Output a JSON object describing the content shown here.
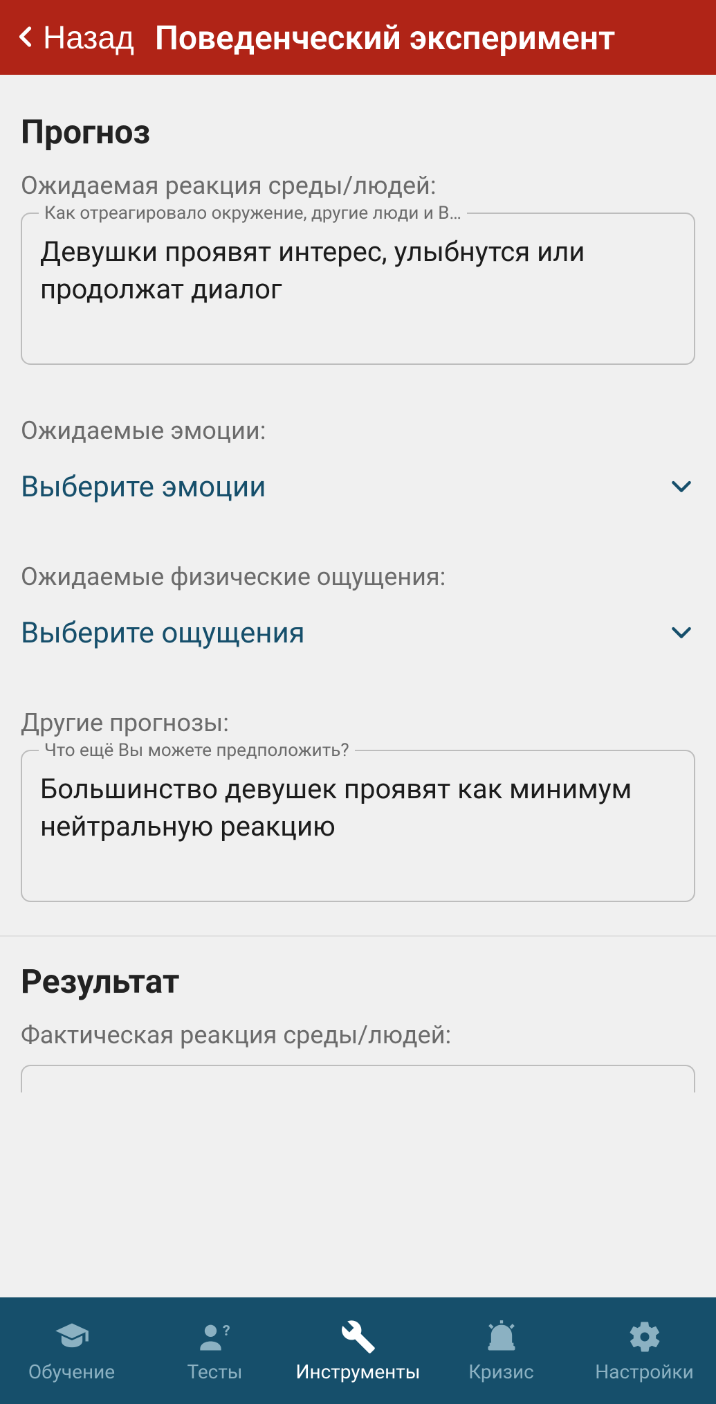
{
  "header": {
    "back_label": "Назад",
    "title": "Поведенческий эксперимент"
  },
  "forecast": {
    "section_title": "Прогноз",
    "expected_reaction_label": "Ожидаемая реакция среды/людей:",
    "expected_reaction_float": "Как отреагировало окружение, другие люди и В…",
    "expected_reaction_value": "Девушки проявят интерес, улыбнутся или продолжат диалог",
    "expected_emotions_label": "Ожидаемые эмоции:",
    "select_emotions_text": "Выберите эмоции",
    "expected_sensations_label": "Ожидаемые физические ощущения:",
    "select_sensations_text": "Выберите ощущения",
    "other_forecasts_label": "Другие прогнозы:",
    "other_forecasts_float": "Что ещё Вы можете предположить?",
    "other_forecasts_value": "Большинство девушек проявят как минимум нейтральную реакцию"
  },
  "result": {
    "section_title": "Результат",
    "actual_reaction_label": "Фактическая реакция среды/людей:"
  },
  "nav": {
    "learn": "Обучение",
    "tests": "Тесты",
    "tools": "Инструменты",
    "crisis": "Кризис",
    "settings": "Настройки"
  }
}
